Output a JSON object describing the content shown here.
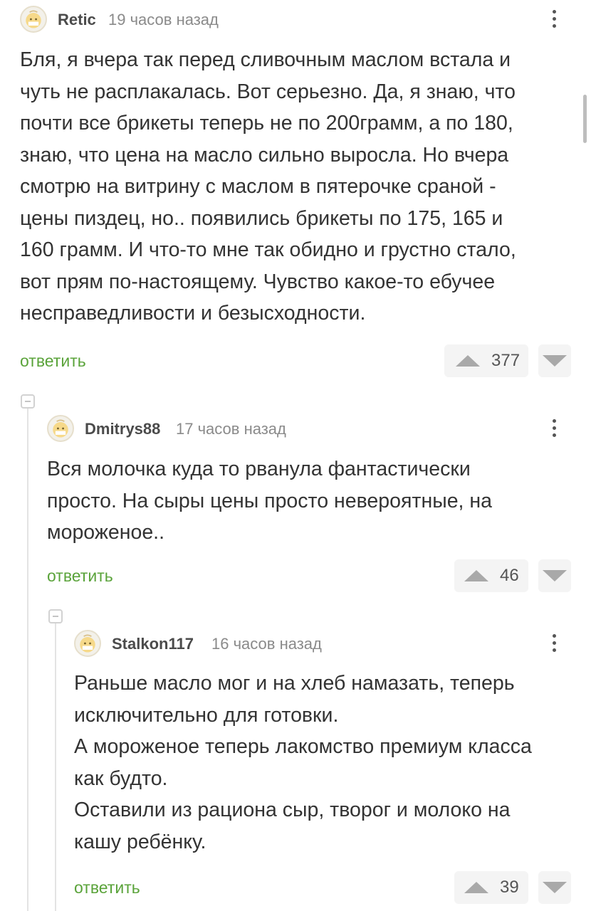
{
  "comments": [
    {
      "author": "Retic",
      "time": "19 часов назад",
      "text": "Бля, я вчера так перед сливочным маслом встала и\nчуть не расплакалась. Вот серьезно. Да, я знаю, что\nпочти все брикеты теперь не по 200грамм, а по 180,\nзнаю, что цена на масло сильно выросла. Но вчера\nсмотрю на витрину с маслом в пятерочке сраной -\nцены пиздец, но.. появились брикеты по 175, 165 и\n160 грамм. И что-то мне так обидно и грустно стало,\nвот прям по-настоящему. Чувство какое-то ебучее\nнесправедливости и безысходности.",
      "reply_label": "ответить",
      "rating": "377"
    },
    {
      "author": "Dmitrys88",
      "time": "17 часов назад",
      "text": "Вся молочка куда то рванула фантастически\nпросто. На сыры цены просто невероятные, на\nмороженое..",
      "reply_label": "ответить",
      "rating": "46"
    },
    {
      "author": "Stalkon117",
      "time": "16 часов назад",
      "text": "Раньше масло мог и на хлеб намазать, теперь\nисключительно для готовки.\nА мороженое теперь лакомство премиум класса\nкак будто.\nОставили из рациона сыр, творог и молоко на\nкашу ребёнку.",
      "reply_label": "ответить",
      "rating": "39"
    }
  ],
  "colors": {
    "reply": "#5aa33a",
    "vote_bg": "#f4f4f4",
    "arrow": "#a9a9a9"
  }
}
